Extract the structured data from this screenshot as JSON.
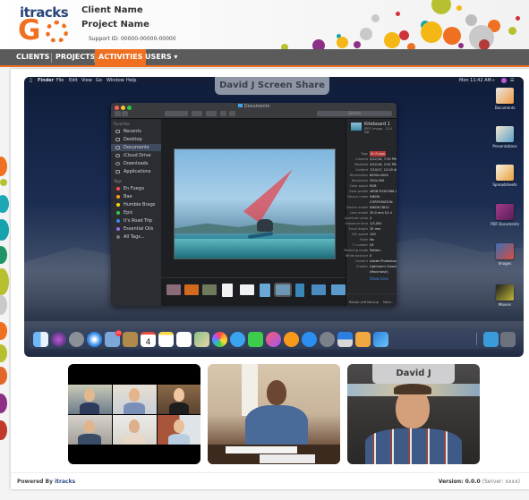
{
  "header": {
    "logo_top": "itracks",
    "logo_bottom": "G",
    "client_name": "Client Name",
    "project_name": "Project Name",
    "support_id": "Support ID: 00000-00000-00000"
  },
  "nav": {
    "items": [
      {
        "label": "CLIENTS",
        "active": false
      },
      {
        "label": "PROJECTS",
        "active": false
      },
      {
        "label": "ACTIVITIES",
        "active": true
      },
      {
        "label": "USERS ▾",
        "active": false
      }
    ],
    "accent_color": "#f07022",
    "bar_color": "#5b5b5b"
  },
  "screen_share": {
    "label": "David J Screen Share",
    "menubar": {
      "app_menus": [
        "",
        "Finder",
        "File",
        "Edit",
        "View",
        "Go",
        "Window",
        "Help"
      ],
      "clock": "Mon 11:42 AM"
    },
    "finder": {
      "title": "Documents",
      "search_placeholder": "Search",
      "favorites_heading": "Favorites",
      "favorites": [
        "Recents",
        "Desktop",
        "Documents",
        "iCloud Drive",
        "Downloads",
        "Applications"
      ],
      "selected_favorite": "Documents",
      "tags_heading": "Tags",
      "tags": [
        {
          "label": "En Fuego",
          "color": "#ff4d4d"
        },
        {
          "label": "Bae",
          "color": "#ff9f1a"
        },
        {
          "label": "Humble Brags",
          "color": "#f5d312"
        },
        {
          "label": "Epic",
          "color": "#35c94a"
        },
        {
          "label": "It's Road Trip",
          "color": "#2e8cf0"
        },
        {
          "label": "Essential Oils",
          "color": "#9b6cf2"
        },
        {
          "label": "All Tags...",
          "color": "#777777"
        }
      ],
      "inspector": {
        "file_name": "Kiteboard 1",
        "file_type": "JPEG image - 15.4 MB",
        "rows": [
          {
            "k": "Tags",
            "v": "En Fuego"
          },
          {
            "k": "Created",
            "v": "5/22/18, 7:39 PM"
          },
          {
            "k": "Modified",
            "v": "5/22/18, 2:54 PM"
          },
          {
            "k": "Content",
            "v": "7/10/17, 12:00 AM"
          },
          {
            "k": "Dimensions",
            "v": "6000×4004"
          },
          {
            "k": "Resolution",
            "v": "300×300"
          },
          {
            "k": "Color space",
            "v": "RGB"
          },
          {
            "k": "Color profile",
            "v": "sRGB IEC61966-2.1"
          },
          {
            "k": "Device make",
            "v": "NIKON"
          },
          {
            "k": "",
            "v": "CORPORATION"
          },
          {
            "k": "Device model",
            "v": "NIKON D810"
          },
          {
            "k": "Lens model",
            "v": "35.0 mm f/1.4"
          },
          {
            "k": "Aperture value",
            "v": "4"
          },
          {
            "k": "Exposure time",
            "v": "1/3,000"
          },
          {
            "k": "Focal length",
            "v": "35 mm"
          },
          {
            "k": "ISO speed",
            "v": "100"
          },
          {
            "k": "Flash",
            "v": "No"
          },
          {
            "k": "F number",
            "v": "f/4"
          },
          {
            "k": "Metering mode",
            "v": "Pattern"
          },
          {
            "k": "White balance",
            "v": "0"
          },
          {
            "k": "Content",
            "v": "Adobe Photoshop"
          },
          {
            "k": "Creator",
            "v": "Lightroom Classic 7.1"
          },
          {
            "k": "",
            "v": "(Macintosh)"
          }
        ],
        "show_less": "Show Less",
        "actions": [
          "Rotate Left",
          "Markup",
          "More..."
        ]
      }
    },
    "desktop_icons": [
      "Documents",
      "Presentations",
      "Spreadsheets",
      "PDF Documents",
      "Images",
      "Movies"
    ],
    "dock": {
      "apps": [
        "Finder",
        "Siri",
        "Launchpad",
        "Safari",
        "Mail",
        "Contacts",
        "Calendar",
        "Notes",
        "Reminders",
        "Maps",
        "Photos",
        "Messages",
        "FaceTime",
        "iTunes",
        "iBooks",
        "App Store",
        "System Preferences",
        "Keynote",
        "Pages",
        "Xcode"
      ],
      "calendar_day": "4",
      "mail_badge": "30",
      "extras": [
        "Downloads",
        "Trash"
      ]
    }
  },
  "video_tiles": [
    {
      "type": "grid",
      "participants": 6
    },
    {
      "type": "presenter"
    },
    {
      "type": "speaker",
      "name": "David J"
    }
  ],
  "footer": {
    "powered_prefix": "Powered By",
    "powered_brand": "itracks",
    "version_label": "Version: 0.0.0",
    "server": "(Server: xxxx)"
  }
}
